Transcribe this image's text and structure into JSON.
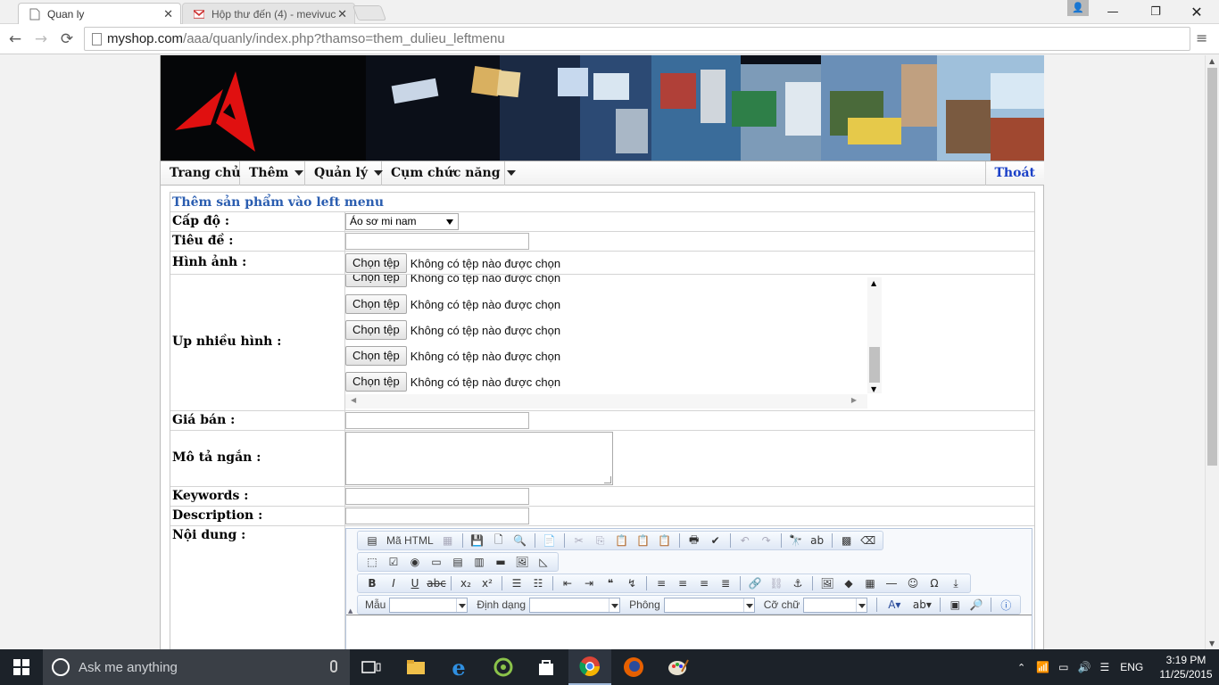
{
  "browser": {
    "tabs": [
      {
        "title": "Quan ly",
        "active": true
      },
      {
        "title": "Hộp thư đến (4) - mevivuc",
        "active": false
      }
    ],
    "url_host": "myshop.com",
    "url_path": "/aaa/quanly/index.php?thamso=them_dulieu_leftmenu"
  },
  "nav": {
    "items": [
      {
        "label": "Trang chủ",
        "dropdown": false
      },
      {
        "label": "Thêm",
        "dropdown": true
      },
      {
        "label": "Quản lý",
        "dropdown": true
      },
      {
        "label": "Cụm chức năng",
        "dropdown": true
      }
    ],
    "logout": "Thoát"
  },
  "form": {
    "title": "Thêm sản phẩm vào left menu",
    "level_label": "Cấp độ :",
    "level_value": "Áo sơ mi nam",
    "title_label": "Tiêu đề :",
    "image_label": "Hình ảnh :",
    "file_button": "Chọn tệp",
    "file_status": "Không có tệp nào được chọn",
    "multi_label": "Up nhiều hình :",
    "price_label": "Giá bán :",
    "short_desc_label": "Mô tả ngắn :",
    "keywords_label": "Keywords :",
    "description_label": "Description :",
    "content_label": "Nội dung :"
  },
  "editor": {
    "source_label": "Mã HTML",
    "style_label": "Mẫu",
    "format_label": "Định dạng",
    "font_label": "Phông",
    "size_label": "Cỡ chữ"
  },
  "taskbar": {
    "search_placeholder": "Ask me anything",
    "language": "ENG",
    "time": "3:19 PM",
    "date": "11/25/2015"
  },
  "colors": {
    "accent_link": "#1a40c8",
    "form_title": "#2a5db0",
    "taskbar": "#1c2229"
  }
}
